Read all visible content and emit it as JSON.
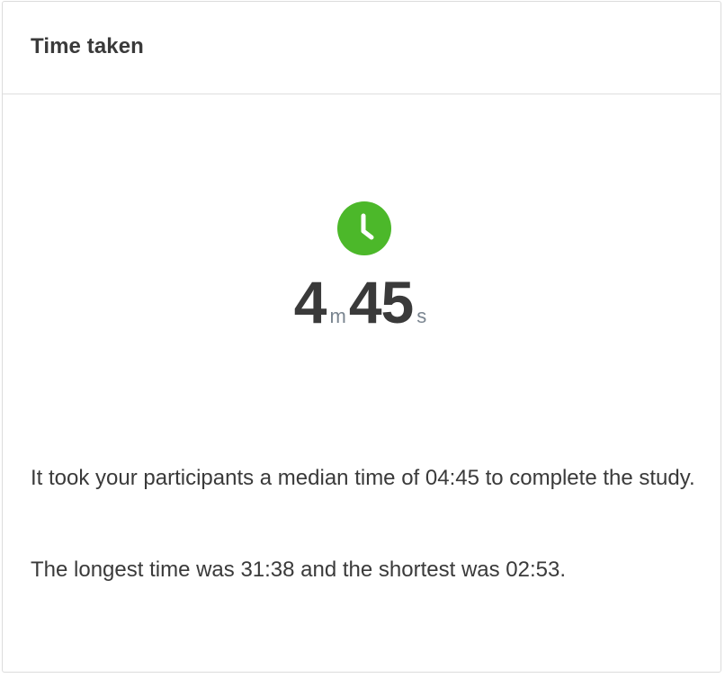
{
  "card": {
    "title": "Time taken"
  },
  "timer": {
    "icon": "clock-icon",
    "icon_color": "#4cb82a",
    "minutes": "4",
    "minutes_unit": "m",
    "seconds": "45",
    "seconds_unit": "s"
  },
  "summary": {
    "median_text": "It took your participants a median time of 04:45 to complete the study.",
    "range_text": "The longest time was 31:38 and the shortest was 02:53."
  }
}
